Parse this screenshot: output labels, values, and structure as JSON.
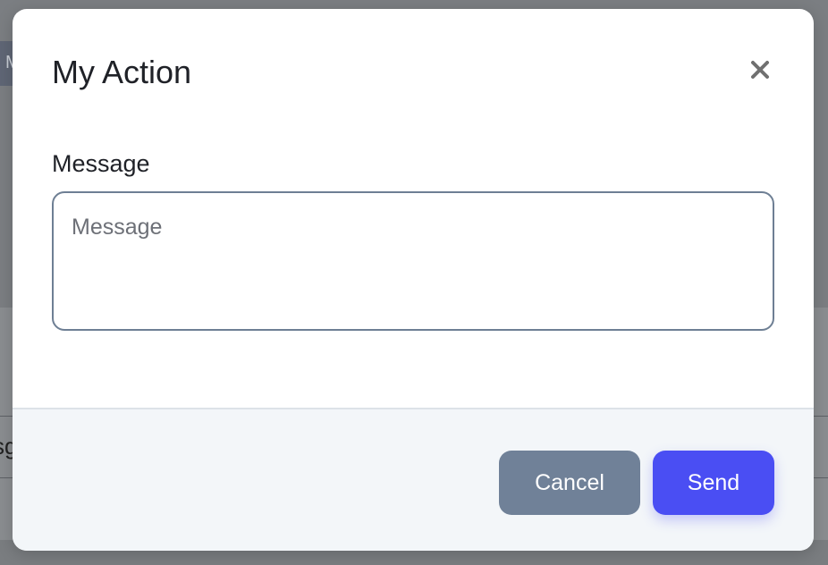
{
  "background": {
    "tab_letter": "M",
    "cell_text": "sg"
  },
  "modal": {
    "title": "My Action",
    "close_icon": "close-icon",
    "field": {
      "label": "Message",
      "value": "",
      "placeholder": "Message"
    },
    "footer": {
      "cancel_label": "Cancel",
      "send_label": "Send"
    }
  },
  "colors": {
    "primary": "#4a4ef3",
    "secondary": "#708198",
    "input_border": "#6e7f94",
    "footer_bg": "#f3f6f9",
    "backdrop": "#7b7e82"
  }
}
